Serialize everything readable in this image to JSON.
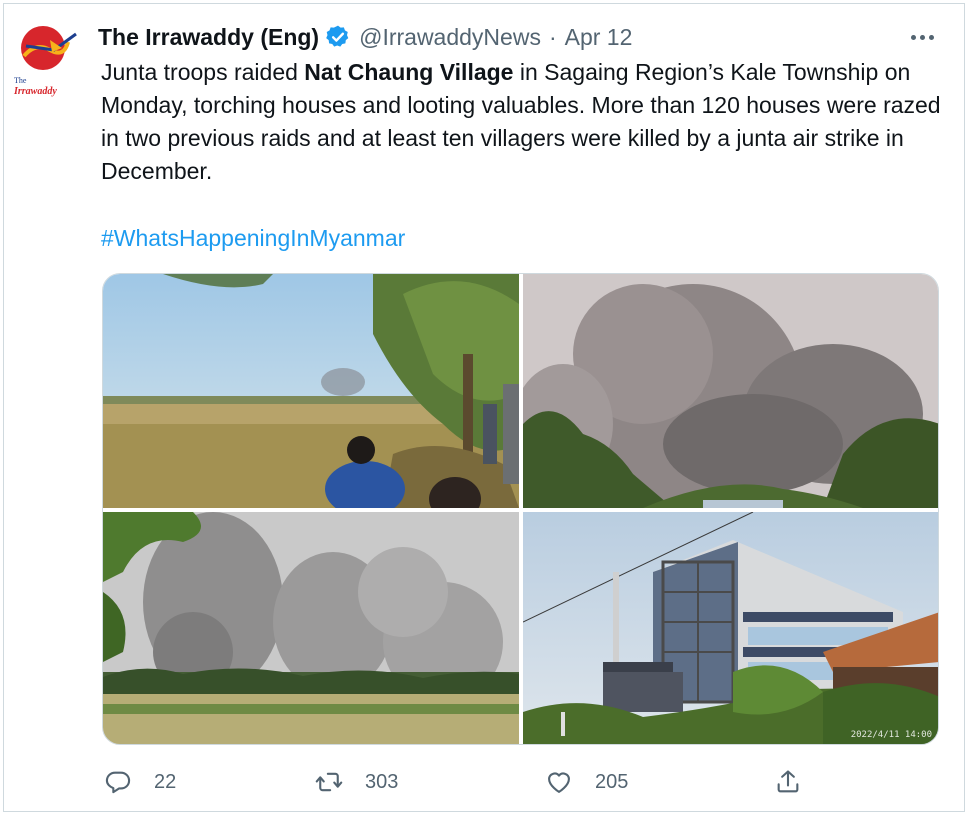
{
  "tweet": {
    "author_name": "The Irrawaddy (Eng)",
    "handle": "@IrrawaddyNews",
    "separator": "·",
    "date": "Apr 12",
    "logo_text_small": "The",
    "logo_text": "Irrawaddy",
    "text_before": "Junta troops raided ",
    "text_bold": "Nat Chaung Village",
    "text_after": " in Sagaing Region’s Kale Township on Monday, torching houses and looting valuables. More than 120 houses were razed in two previous raids and at least ten villagers were killed by a junta air strike in December.",
    "hashtag": "#WhatsHappeningInMyanmar",
    "photo4_timestamp": "2022/4/11 14:00"
  },
  "actions": {
    "reply_count": "22",
    "retweet_count": "303",
    "like_count": "205"
  },
  "icons": {
    "verified": "verified-badge-icon",
    "more": "more-options-icon",
    "reply": "reply-icon",
    "retweet": "retweet-icon",
    "like": "heart-icon",
    "share": "share-icon"
  },
  "colors": {
    "accent": "#1d9bf0",
    "secondary_text": "#536471",
    "primary_text": "#0f1419",
    "logo_red": "#d7262c"
  }
}
